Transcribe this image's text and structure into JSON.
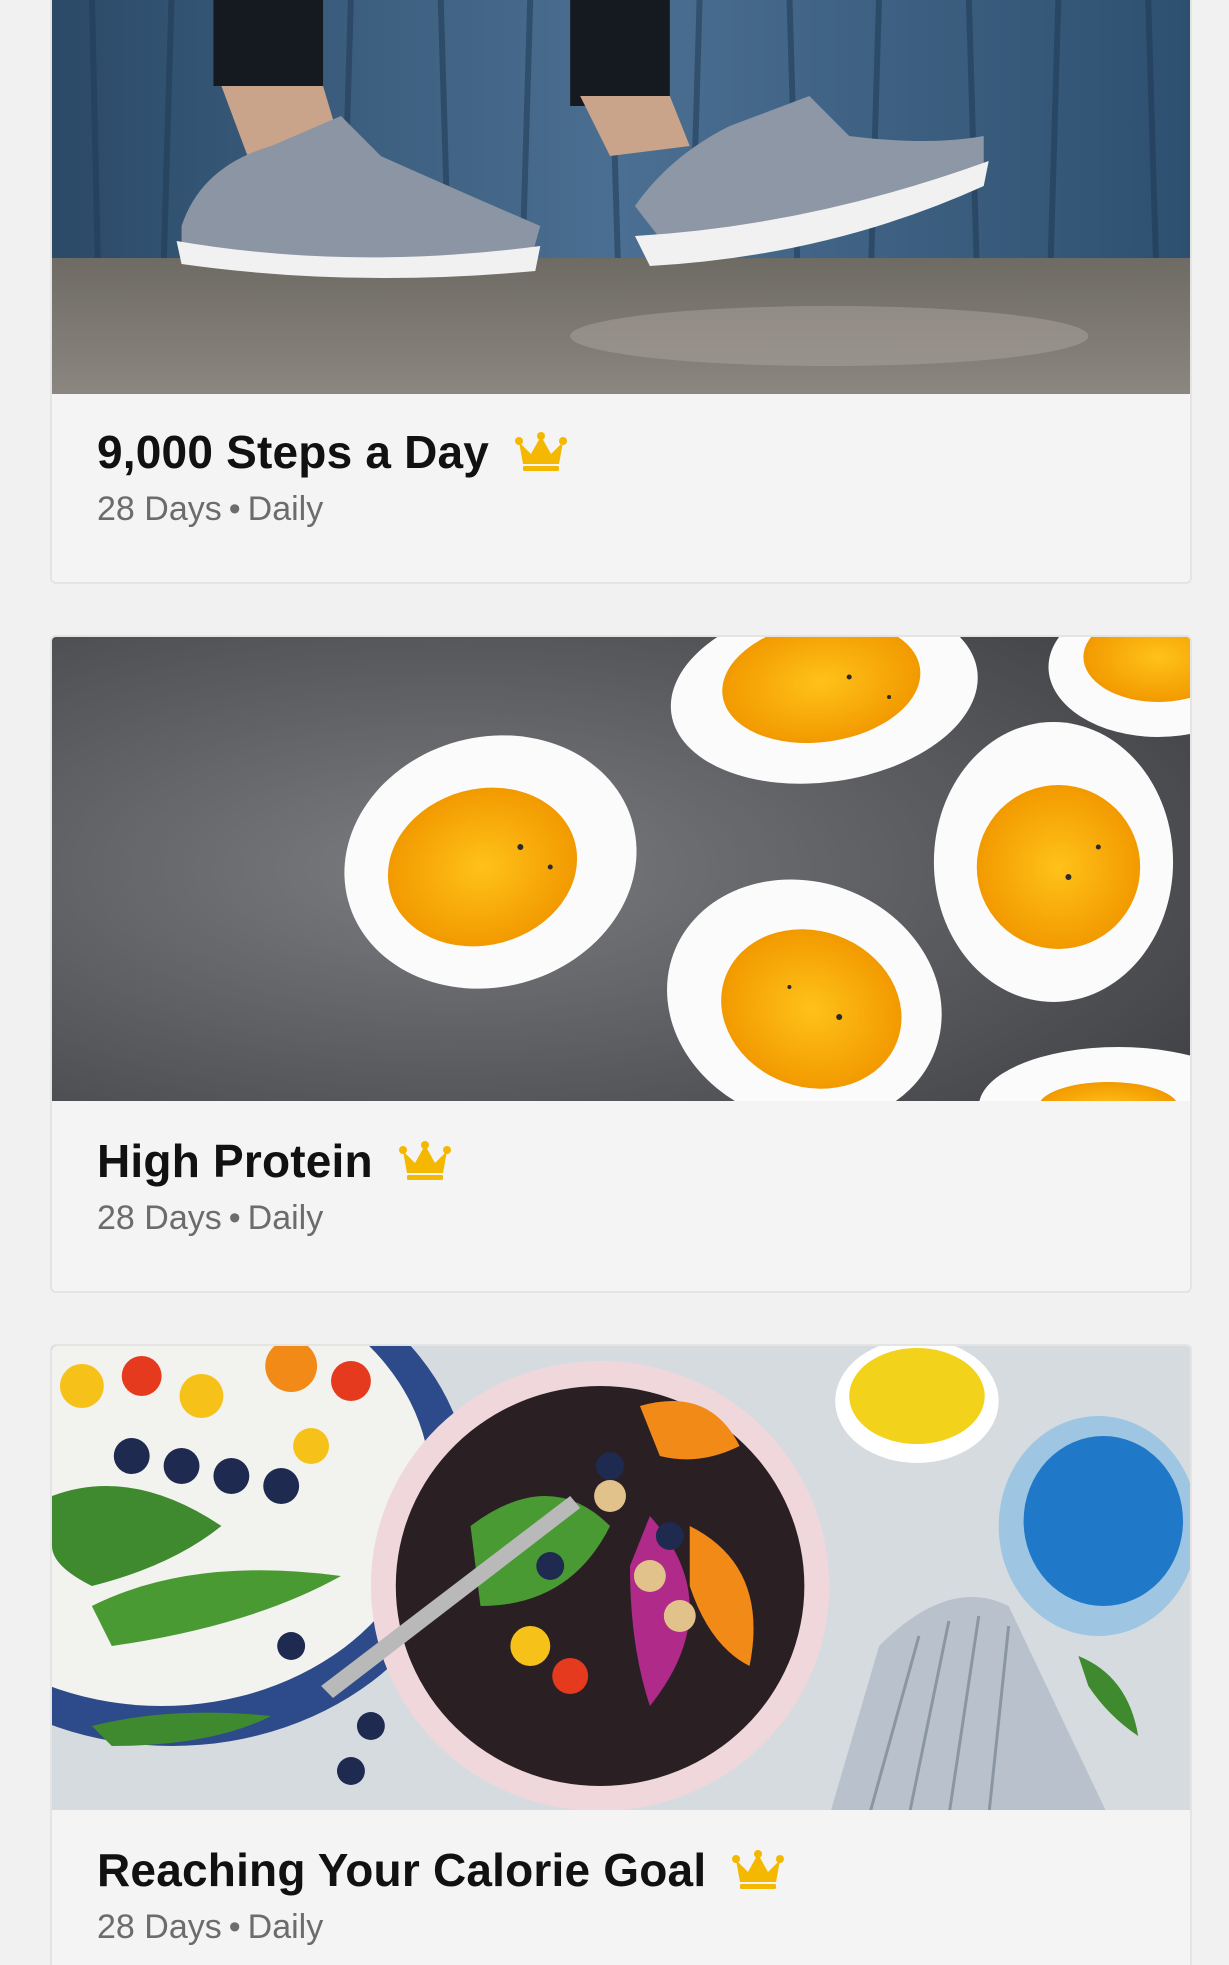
{
  "cards": [
    {
      "title": "9,000 Steps a Day",
      "duration": "28 Days",
      "separator": "•",
      "frequency": "Daily",
      "image": "walking-sneakers-photo",
      "badge_icon": "crown-icon"
    },
    {
      "title": "High Protein",
      "duration": "28 Days",
      "separator": "•",
      "frequency": "Daily",
      "image": "boiled-eggs-photo",
      "badge_icon": "crown-icon"
    },
    {
      "title": "Reaching Your Calorie Goal",
      "duration": "28 Days",
      "separator": "•",
      "frequency": "Daily",
      "image": "salad-bowl-photo",
      "badge_icon": "crown-icon"
    }
  ],
  "colors": {
    "background": "#f1f1f1",
    "card": "#f4f4f4",
    "title": "#111111",
    "subtitle": "#6c6c6c",
    "premium_crown": "#f5b800"
  }
}
